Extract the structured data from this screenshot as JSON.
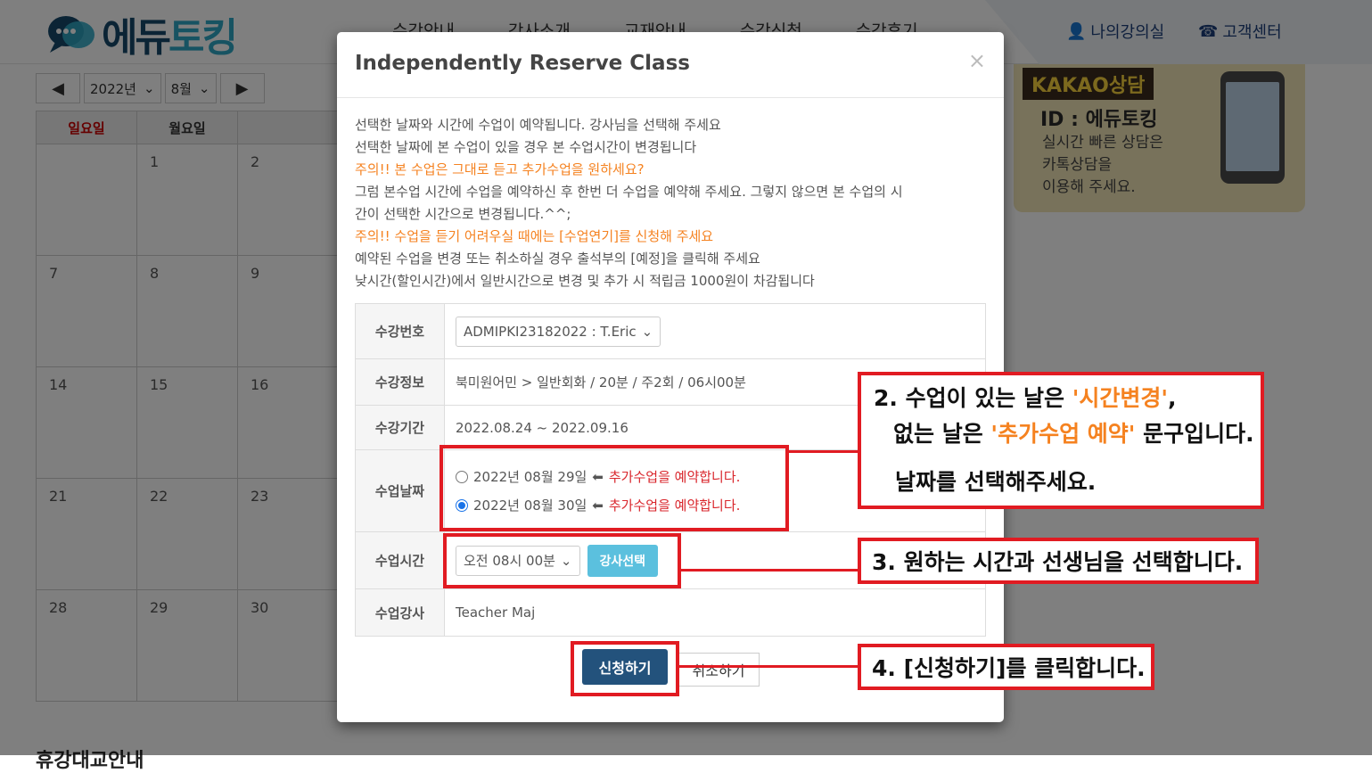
{
  "header": {
    "logo_text_1": "에듀",
    "logo_text_2": "토킹",
    "nav": [
      "수강안내",
      "강사소개",
      "교재안내",
      "수강신청",
      "수강후기"
    ],
    "my_class": "나의강의실",
    "customer_center": "고객센터"
  },
  "calendar": {
    "prev": "◀",
    "next": "▶",
    "year": "2022년",
    "month": "8월",
    "headers": [
      "일요일",
      "월요일"
    ],
    "rows": [
      [
        "",
        "1",
        "2"
      ],
      [
        "7",
        "8",
        "9"
      ],
      [
        "14",
        "15",
        "16"
      ],
      [
        "21",
        "22",
        "23"
      ],
      [
        "28",
        "29",
        "30"
      ]
    ]
  },
  "kakao": {
    "title": "KAKAO상담",
    "id": "ID : 에듀토킹",
    "desc_1": "실시간 빠른 상담은",
    "desc_2": "카톡상담을",
    "desc_3": "이용해 주세요."
  },
  "bottom_title": "휴강대교안내",
  "modal": {
    "title": "Independently Reserve Class",
    "close": "×",
    "notice": [
      "선택한 날짜와 시간에 수업이 예약됩니다. 강사님을 선택해 주세요",
      "선택한 날짜에 본 수업이 있을 경우 본 수업시간이 변경됩니다",
      "주의!! 본 수업은 그대로 듣고 추가수업을 원하세요?",
      "그럼 본수업 시간에 수업을 예약하신 후 한번 더 수업을 예약해 주세요. 그렇지 않으면 본 수업의 시",
      "간이 선택한 시간으로 변경됩니다.^^;",
      "주의!! 수업을 듣기 어려우실 때에는 [수업연기]를 신청해 주세요",
      "예약된 수업을 변경 또는 취소하실 경우 출석부의 [예정]을 클릭해 주세요",
      "낮시간(할인시간)에서 일반시간으로 변경 및 추가 시 적립금 1000원이 차감됩니다"
    ],
    "labels": {
      "course_no": "수강번호",
      "course_info": "수강정보",
      "course_period": "수강기간",
      "class_date": "수업날짜",
      "class_time": "수업시간",
      "class_teacher": "수업강사"
    },
    "course_no_value": "ADMIPKI23182022 : T.Eric",
    "course_info_value": "북미원어민 > 일반회화 / 20분 / 주2회 / 06시00분",
    "course_period_value": "2022.08.24 ~ 2022.09.16",
    "dates": [
      {
        "date": "2022년 08월 29일",
        "arrow": "⬅",
        "note": "추가수업을 예약합니다.",
        "selected": false
      },
      {
        "date": "2022년 08월 30일",
        "arrow": "⬅",
        "note": "추가수업을 예약합니다.",
        "selected": true
      }
    ],
    "time_value": "오전 08시 00분",
    "select_teacher": "강사선택",
    "teacher_value": "Teacher Maj",
    "apply": "신청하기",
    "cancel": "취소하기"
  },
  "callouts": {
    "c2_prefix": "2. 수업이 있는 날은 ",
    "c2_time_change": "'시간변경'",
    "c2_comma": ",",
    "c2_line2_prefix": "없는 날은 ",
    "c2_extra": "'추가수업 예약'",
    "c2_line2_suffix": " 문구입니다.",
    "c2_line3": "날짜를 선택해주세요.",
    "c3": "3. 원하는 시간과 선생님을 선택합니다.",
    "c4": "4. [신청하기]를 클릭합니다."
  },
  "colors": {
    "annotation_red": "#e11b22",
    "orange": "#f58220",
    "primary_button": "#23527c",
    "info_button": "#5bc0de"
  }
}
